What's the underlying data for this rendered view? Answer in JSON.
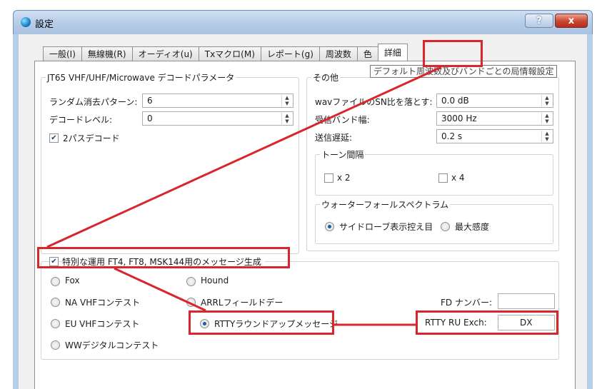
{
  "window": {
    "title": "設定",
    "help_label": "?",
    "close_label": "x"
  },
  "tabs": [
    "一般(I)",
    "無線機(R)",
    "オーディオ(u)",
    "Txマクロ(M)",
    "レポート(g)",
    "周波数",
    "色",
    "詳細"
  ],
  "tooltip": "デフォルト周波数及びバンドごとの局情報設定",
  "decode_params": {
    "title": "JT65 VHF/UHF/Microwave デコードパラメータ",
    "random_erasure_label": "ランダム消去パターン:",
    "random_erasure_value": "6",
    "decode_level_label": "デコードレベル:",
    "decode_level_value": "0",
    "two_pass_label": "2パスデコード",
    "two_pass_checked": true
  },
  "misc": {
    "title": "その他",
    "wav_snr_label": "wavファイルのSN比を落とす:",
    "wav_snr_value": "0.0 dB",
    "rx_bandwidth_label": "受信バンド幅:",
    "rx_bandwidth_value": "3000  Hz",
    "tx_delay_label": "送信遅延:",
    "tx_delay_value": "0.2  s",
    "tone_spacing": {
      "title": "トーン間隔",
      "x2_label": "x 2",
      "x4_label": "x 4"
    },
    "waterfall": {
      "title": "ウォーターフォールスペクトラム",
      "opt1_label": "サイドローブ表示控え目",
      "opt2_label": "最大感度",
      "selected": "opt1"
    }
  },
  "special_op": {
    "label": "特別な運用  FT4, FT8, MSK144用のメッセージ生成",
    "checked": true,
    "options": {
      "fox": "Fox",
      "hound": "Hound",
      "na_vhf": "NA VHFコンテスト",
      "arrl_field_day": "ARRLフィールドデー",
      "eu_vhf": "EU VHFコンテスト",
      "rtty_roundup": "RTTYラウンドアップメッセージ",
      "ww_digi": "WWデジタルコンテスト"
    },
    "selected": "rtty_roundup",
    "fd_number_label": "FD ナンバー:",
    "fd_number_value": "",
    "rtty_exch_label": "RTTY RU Exch:",
    "rtty_exch_value": "DX"
  },
  "colors": {
    "highlight": "#d9262c",
    "radio_selected": "#1f59a8"
  },
  "icons": {
    "app": "wsjt-app-icon",
    "spin": "spin-arrows-icon",
    "check": "checkmark-icon"
  }
}
